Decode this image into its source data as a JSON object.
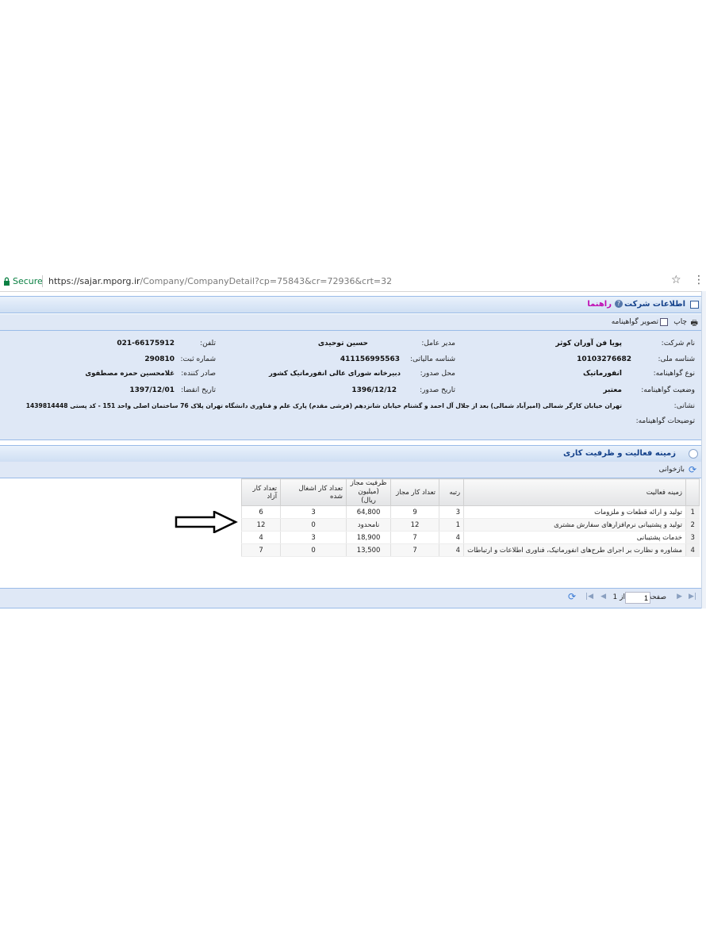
{
  "browser": {
    "secure_label": "Secure",
    "url_host": "https://sajar.mporg.ir",
    "url_path": "/Company/CompanyDetail?cp=75843&cr=72936&crt=32"
  },
  "company_panel": {
    "title": "اطلاعات شرکت",
    "help_label": "راهنما",
    "print_label": "چاپ",
    "cert_image_label": "تصویر گواهینامه",
    "fields": {
      "name_label": "نام شرکت:",
      "name_value": "پویا فن آوران کوثر",
      "manager_label": "مدیر عامل:",
      "manager_value": "حسین توحیدی",
      "phone_label": "تلفن:",
      "phone_value": "021-66175912",
      "national_id_label": "شناسه ملی:",
      "national_id_value": "10103276682",
      "tax_id_label": "شناسه مالیاتی:",
      "tax_id_value": "411156995563",
      "reg_no_label": "شماره ثبت:",
      "reg_no_value": "290810",
      "cert_type_label": "نوع گواهینامه:",
      "cert_type_value": "انفورماتیک",
      "issue_place_label": "محل صدور:",
      "issue_place_value": "دبیرخانه شورای عالی انفورماتیک کشور",
      "issuer_label": "صادر کننده:",
      "issuer_value": "غلامحسین حمزه مصطفوی",
      "cert_status_label": "وضعیت گواهینامه:",
      "cert_status_value": "معتبر",
      "issue_date_label": "تاریخ صدور:",
      "issue_date_value": "1396/12/12",
      "expiry_label": "تاریخ انقضا:",
      "expiry_value": "1397/12/01",
      "address_label": "نشانی:",
      "address_value": "تهران خیابان کارگر شمالی (امیرآباد شمالی) بعد از جلال آل احمد و گشتام خیابان شانزدهم (فرشی مقدم) پارک علم و فناوری دانشگاه تهران پلاک 76 ساختمان اصلی واحد 151 - کد پستی 1439814448",
      "notes_label": "توضیحات گواهینامه:"
    }
  },
  "activity_panel": {
    "title": "زمینه فعالیت و ظرفیت کاری",
    "refresh_label": "بازخوانی",
    "columns": [
      "",
      "زمینه فعالیت",
      "رتبه",
      "تعداد کار مجاز",
      "ظرفیت مجاز (میلیون ریال)",
      "تعداد کار اشغال شده",
      "تعداد کار آزاد"
    ],
    "rows": [
      {
        "n": "1",
        "field": "تولید و ارائه قطعات و ملزومات",
        "rank": "3",
        "allowed": "9",
        "capacity": "64,800",
        "occupied": "3",
        "free": "6"
      },
      {
        "n": "2",
        "field": "تولید و پشتیبانی نرم‌افزارهای سفارش مشتری",
        "rank": "1",
        "allowed": "12",
        "capacity": "نامحدود",
        "occupied": "0",
        "free": "12"
      },
      {
        "n": "3",
        "field": "خدمات پشتیبانی",
        "rank": "4",
        "allowed": "7",
        "capacity": "18,900",
        "occupied": "3",
        "free": "4"
      },
      {
        "n": "4",
        "field": "مشاوره و نظارت بر اجرای طرح‌های انفورماتیک، فناوری اطلاعات و ارتباطات",
        "rank": "4",
        "allowed": "7",
        "capacity": "13,500",
        "occupied": "0",
        "free": "7"
      }
    ],
    "pager": {
      "page_label": "صفحه",
      "page_value": "1",
      "of_label": "از 1"
    }
  },
  "colors": {
    "panel_bg": "#dfe8f6",
    "header_text": "#15428b",
    "help_text": "#c00bb3",
    "secure_green": "#0b8043"
  }
}
